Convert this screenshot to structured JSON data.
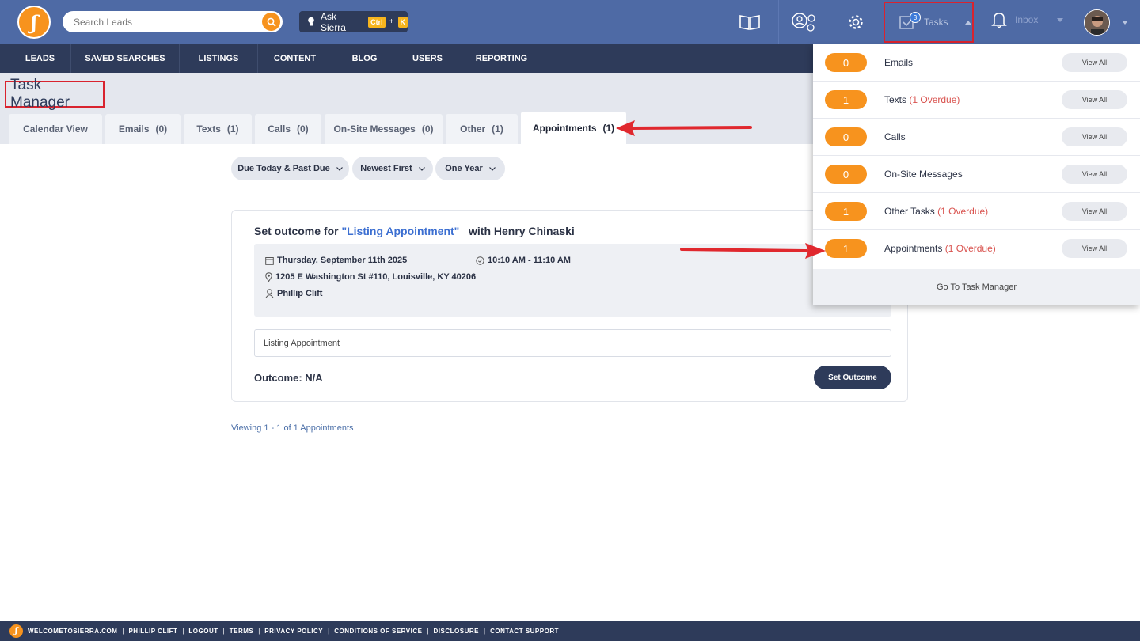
{
  "header": {
    "logo_glyph": "ʃ",
    "search_placeholder": "Search Leads",
    "ask_label": "Ask Sierra",
    "ask_kbd_1": "Ctrl",
    "ask_plus": "+",
    "ask_kbd_2": "K",
    "tasks_label": "Tasks",
    "tasks_badge": "3",
    "inbox_label": "Inbox"
  },
  "nav": [
    "LEADS",
    "SAVED SEARCHES",
    "LISTINGS",
    "CONTENT",
    "BLOG",
    "USERS",
    "REPORTING"
  ],
  "page": {
    "title": "Task Manager",
    "tabs": [
      {
        "label": "Calendar View",
        "count": ""
      },
      {
        "label": "Emails",
        "count": "(0)"
      },
      {
        "label": "Texts",
        "count": "(1)"
      },
      {
        "label": "Calls",
        "count": "(0)"
      },
      {
        "label": "On-Site Messages",
        "count": "(0)"
      },
      {
        "label": "Other",
        "count": "(1)"
      },
      {
        "label": "Appointments",
        "count": "(1)"
      }
    ],
    "filters": [
      "Due Today & Past Due",
      "Newest First",
      "One Year"
    ]
  },
  "card": {
    "title_prefix": "Set outcome for",
    "title_appt": "\"Listing Appointment\"",
    "title_suffix": "with Henry Chinaski",
    "date": "Thursday, September 11th 2025",
    "time": "10:10 AM - 11:10 AM",
    "address": "1205 E Washington St #110, Louisville, KY 40206",
    "agent": "Phillip Clift",
    "note": "Listing Appointment",
    "outcome": "Outcome: N/A",
    "button": "Set Outcome"
  },
  "viewing": "Viewing 1 - 1 of 1 Appointments",
  "dropdown": {
    "rows": [
      {
        "count": "0",
        "label": "Emails",
        "overdue": "",
        "view": "View All"
      },
      {
        "count": "1",
        "label": "Texts",
        "overdue": "(1 Overdue)",
        "view": "View All"
      },
      {
        "count": "0",
        "label": "Calls",
        "overdue": "",
        "view": "View All"
      },
      {
        "count": "0",
        "label": "On-Site Messages",
        "overdue": "",
        "view": "View All"
      },
      {
        "count": "1",
        "label": "Other Tasks",
        "overdue": "(1 Overdue)",
        "view": "View All"
      },
      {
        "count": "1",
        "label": "Appointments",
        "overdue": "(1 Overdue)",
        "view": "View All"
      }
    ],
    "footer": "Go To Task Manager"
  },
  "footer": {
    "links": [
      "WELCOMETOSIERRA.COM",
      "PHILLIP CLIFT",
      "LOGOUT",
      "TERMS",
      "PRIVACY POLICY",
      "CONDITIONS OF SERVICE",
      "DISCLOSURE",
      "CONTACT SUPPORT"
    ],
    "separator": "|"
  },
  "colors": {
    "brand_orange": "#f7931e",
    "nav_dark": "#2e3b5a",
    "topbar_blue": "#4e6aa5",
    "highlight_red": "#d9232e"
  }
}
